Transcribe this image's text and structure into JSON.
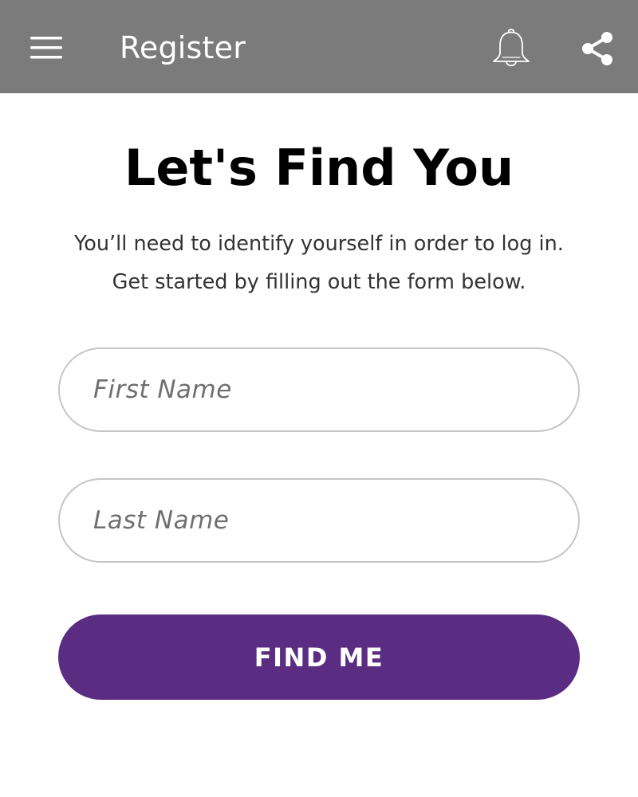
{
  "app_bar": {
    "title": "Register",
    "background": "#7b7b7b",
    "menu_icon": "hamburger-menu-icon",
    "bell_icon": "bell-icon",
    "share_icon": "share-icon"
  },
  "main": {
    "heading": "Let's Find You",
    "intro_line_1": "You’ll need to identify yourself in order to log in.",
    "intro_line_2": "Get started by filling out the form below.",
    "first_name": {
      "value": "",
      "placeholder": "First Name"
    },
    "last_name": {
      "value": "",
      "placeholder": "Last Name"
    },
    "submit_label": "FIND ME",
    "accent_color": "#5b2d82"
  }
}
